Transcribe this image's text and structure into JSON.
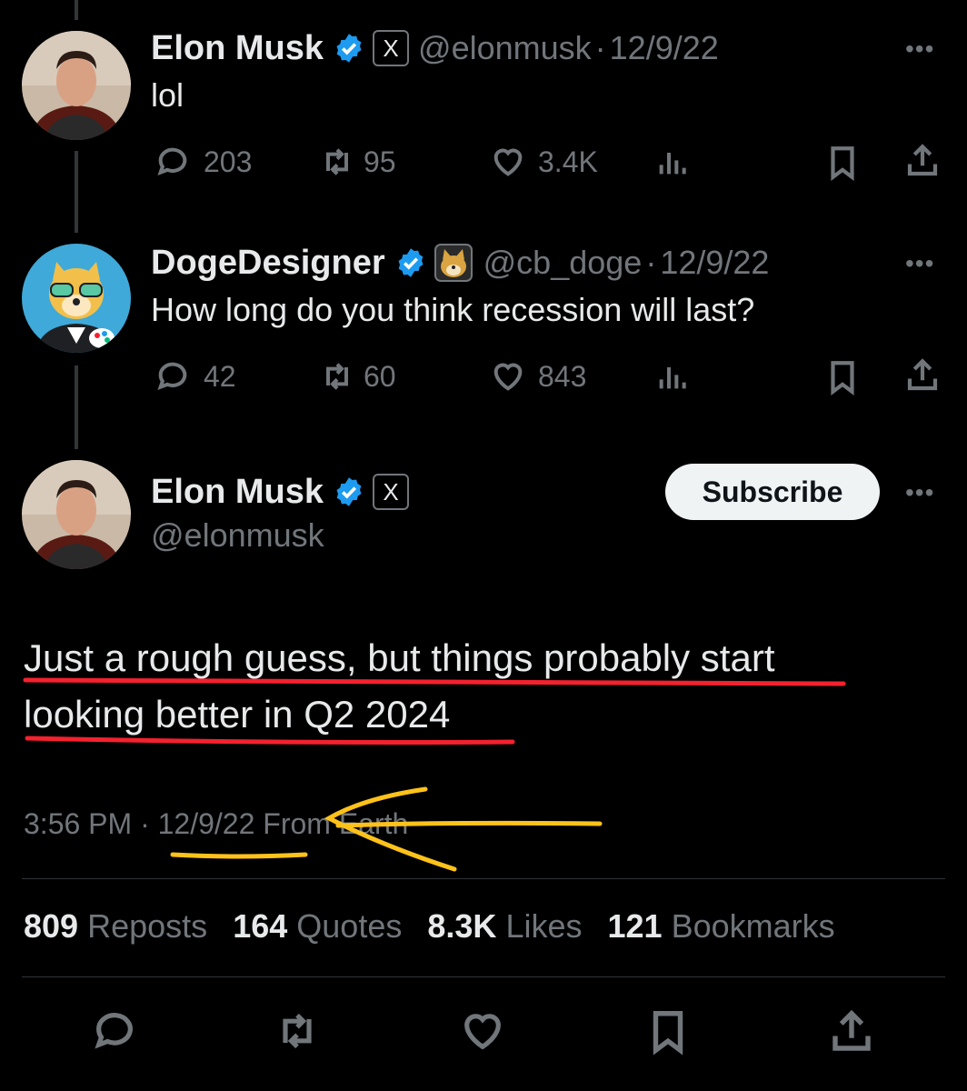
{
  "tweets": [
    {
      "name": "Elon Musk",
      "handle": "@elonmusk",
      "date": "12/9/22",
      "text": "lol",
      "replies": "203",
      "reposts": "95",
      "likes": "3.4K"
    },
    {
      "name": "DogeDesigner",
      "handle": "@cb_doge",
      "date": "12/9/22",
      "text": "How long do you think recession will last?",
      "replies": "42",
      "reposts": "60",
      "likes": "843"
    }
  ],
  "focused": {
    "name": "Elon Musk",
    "handle": "@elonmusk",
    "subscribe_label": "Subscribe",
    "text_line1": "Just a rough guess, but things probably start",
    "text_line2": "looking better in Q2 2024",
    "time": "3:56 PM",
    "date": "12/9/22",
    "location": "From Earth",
    "stats": {
      "reposts_count": "809",
      "reposts_label": "Reposts",
      "quotes_count": "164",
      "quotes_label": "Quotes",
      "likes_count": "8.3K",
      "likes_label": "Likes",
      "bookmarks_count": "121",
      "bookmarks_label": "Bookmarks"
    }
  },
  "separator": "·",
  "more_label": "•••",
  "x_badge": "X",
  "icons": {
    "reply": "reply-icon",
    "repost": "repost-icon",
    "like": "heart-icon",
    "views": "analytics-icon",
    "bookmark": "bookmark-icon",
    "share": "share-icon",
    "verified": "verified-badge-icon"
  },
  "colors": {
    "background": "#000000",
    "text": "#e7e9ea",
    "muted": "#71767b",
    "verified": "#1d9bf0",
    "annotation_red": "#f4212e",
    "annotation_yellow": "#ffc21a"
  }
}
